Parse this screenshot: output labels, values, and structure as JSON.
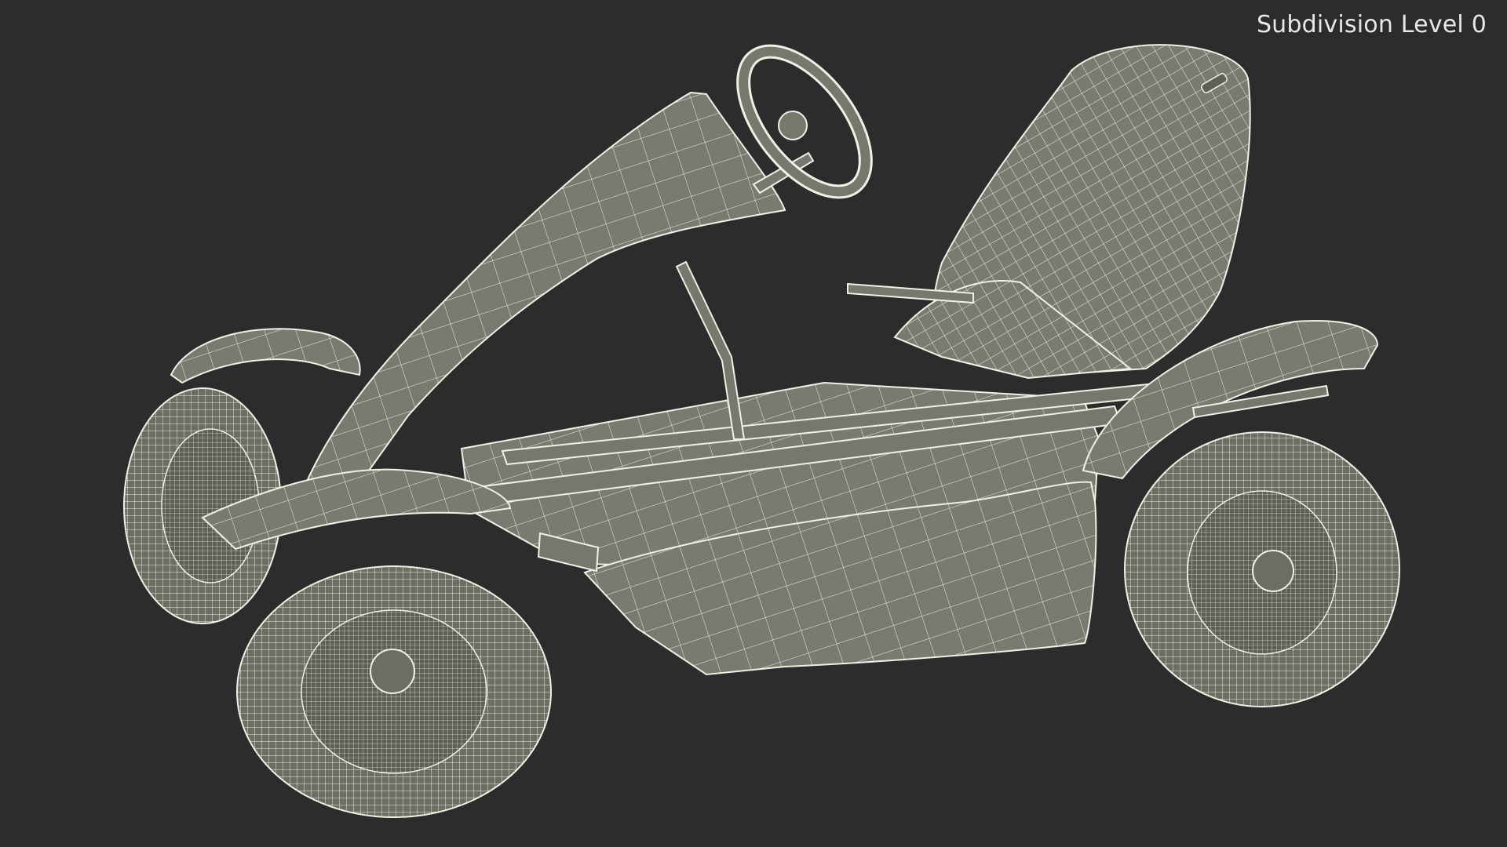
{
  "viewport": {
    "overlay_label": "Subdivision Level 0",
    "background_color": "#2c2c2c",
    "mesh_fill_color": "#77776d",
    "wire_color": "#f2f2ea"
  },
  "model": {
    "icon": "go-kart-wireframe"
  }
}
